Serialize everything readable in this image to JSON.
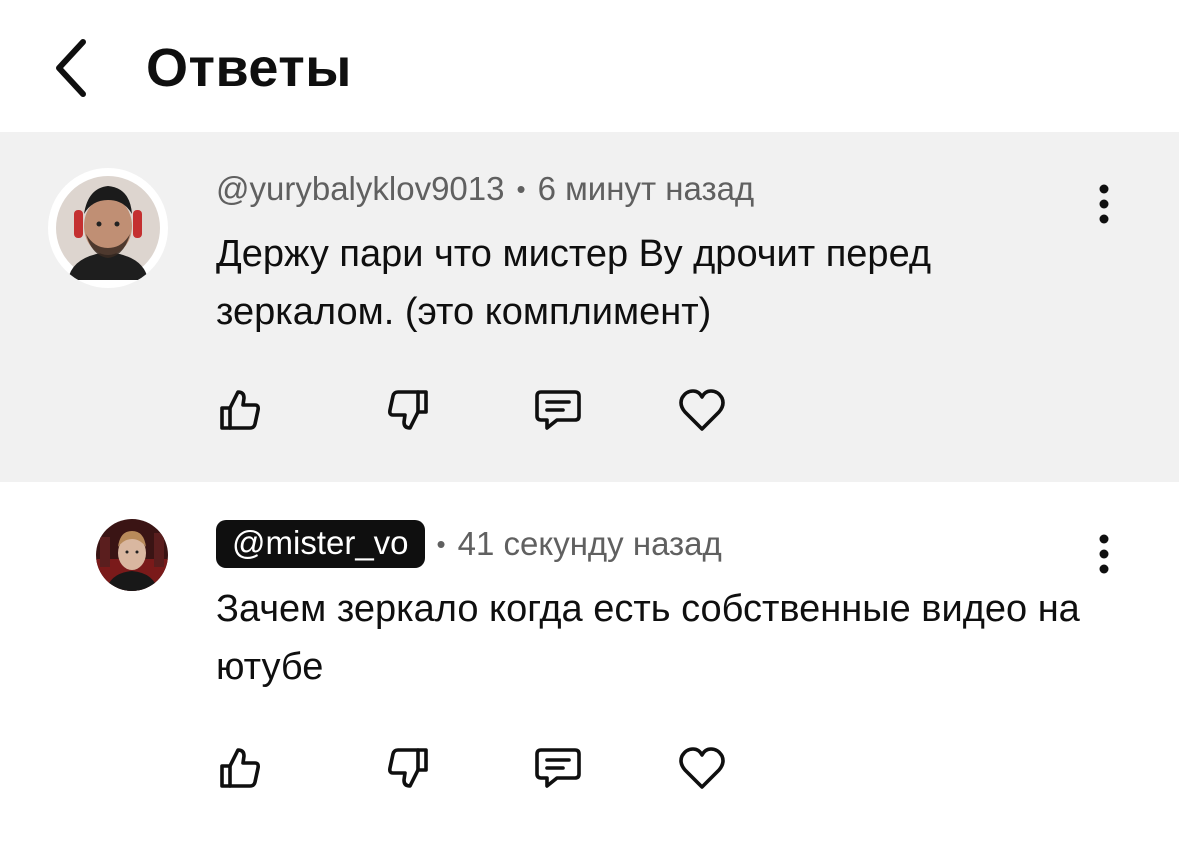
{
  "header": {
    "title": "Ответы",
    "back_icon": "chevron-left-icon"
  },
  "comments": [
    {
      "author": "@yurybalyklov9013",
      "separator": "•",
      "time": "6 минут назад",
      "text": "Держу пари что мистер Ву дрочит перед зеркалом. (это комплимент)",
      "highlighted": true,
      "author_is_creator": false
    },
    {
      "author": "@mister_vo",
      "separator": "•",
      "time": "41 секунду назад",
      "text": "Зачем зеркало когда есть собственные видео на ютубе",
      "highlighted": false,
      "author_is_creator": true
    }
  ],
  "actions": [
    "thumb-up-icon",
    "thumb-down-icon",
    "reply-icon",
    "heart-icon"
  ],
  "colors": {
    "highlight_bg": "#f1f1f1",
    "meta_text": "#606060",
    "creator_pill_bg": "#0f0f0f",
    "text": "#0f0f0f"
  }
}
